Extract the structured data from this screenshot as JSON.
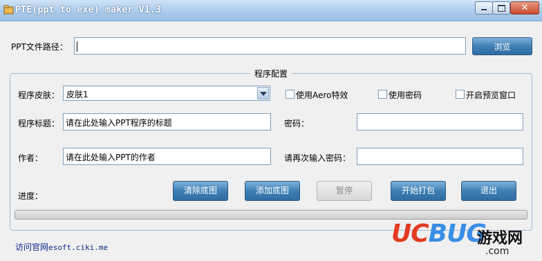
{
  "window": {
    "title": "PTE(ppt to exe) maker V1.3",
    "controls": {
      "minimize": "minimize",
      "maximize": "maximize",
      "close": "✕"
    }
  },
  "ppt_path": {
    "label": "PPT文件路径：",
    "value": "",
    "browse_label": "浏览"
  },
  "config": {
    "group_title": "程序配置",
    "skin": {
      "label": "程序皮肤：",
      "selected": "皮肤1"
    },
    "options": [
      {
        "label": "使用Aero特效",
        "checked": false
      },
      {
        "label": "使用密码",
        "checked": false
      },
      {
        "label": "开启预览窗口",
        "checked": false
      }
    ],
    "title": {
      "label": "程序标题：",
      "value": "请在此处输入PPT程序的标题"
    },
    "author": {
      "label": "作者：",
      "value": "请在此处输入PPT的作者"
    },
    "password": {
      "label": "密码：",
      "value": ""
    },
    "confirm_password": {
      "label": "请再次输入密码：",
      "value": ""
    },
    "progress_label": "进度：",
    "progress_value": 0,
    "buttons": {
      "clear_bg": "清除底图",
      "add_bg": "添加底图",
      "pause": "暂停",
      "start": "开始打包",
      "exit": "退出"
    }
  },
  "footer": {
    "visit_label": "访问官网",
    "url": "esoft.ciki.me"
  },
  "watermark": {
    "brand_uc": "UC",
    "brand_rest": "BUG",
    "cn": "游戏网",
    "site": ".com"
  },
  "colors": {
    "title_text": "#ffffff",
    "button": "#3f7fb3",
    "link": "#0b2a8a",
    "watermark_red": "#e33a22",
    "watermark_blue": "#3a8ee6"
  }
}
